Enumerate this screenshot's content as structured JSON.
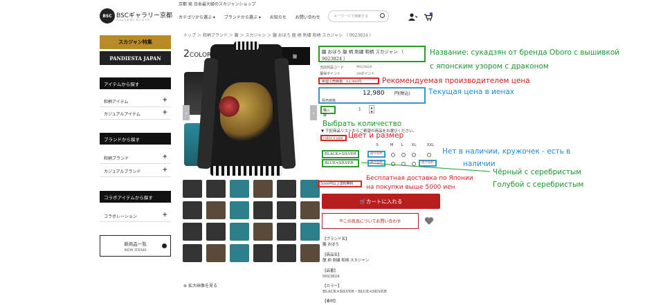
{
  "top_tagline": "京都 発 日本最大級のスカジャンショップ",
  "logo": {
    "mark": "BSC",
    "name": "BSCギャラリー京都",
    "sub": "GALLERY KYOTO"
  },
  "nav": [
    "カテゴリから選ぶ ▾",
    "ブランドから選ぶ ▾",
    "お知らせ",
    "お問い合わせ"
  ],
  "search": {
    "placeholder": "キーワードで検索する"
  },
  "sidebar": {
    "banners": [
      "スカジャン特集",
      "PANDIESTA JAPAN"
    ],
    "sections": [
      {
        "title": "アイテムから探す",
        "items": [
          "和柄アイテム",
          "カジュアルアイテム"
        ]
      },
      {
        "title": "ブランドから探す",
        "items": [
          "和柄ブランド",
          "カジュアルブランド"
        ]
      },
      {
        "title": "コラボアイテムから探す",
        "items": [
          "コラボレーション"
        ]
      }
    ],
    "new_items": {
      "title": "新商品一覧",
      "sub": "NEW ITEMS"
    }
  },
  "breadcrumb": "トップ ＞ 和柄ブランド ＞ 朧 ＞ スカジャン ＞ 朧 おぼろ 龍 柄 刺繍 和柄 スカジャン （ 9023824 ）",
  "gallery": {
    "color_count": "2",
    "color_word": "COLOR",
    "brand_logo": "朧",
    "zoom_label": "拡大画像を見る"
  },
  "product": {
    "title": "朧 おぼろ 龍 柄 刺繍 和柄 スカジャン （ 9023824 ）",
    "code_label": "当店商品コード",
    "code": "9023824",
    "points_label": "獲得ポイント",
    "points": "39ポイント",
    "rec_label": "希望小売価格",
    "rec_price": "12,980円",
    "price": "12,980",
    "price_tax": "円(税込)",
    "price_label": "販売価格",
    "qty_label": "購入数",
    "qty": "1",
    "select_note": "▼ 下記商品リストからご希望の商品をお選びください。",
    "color_size": "color x size",
    "sizes": [
      "S",
      "M",
      "L",
      "XL",
      "XXL"
    ],
    "variants": [
      "BLACK×SILVER",
      "BLUE×SILVER"
    ],
    "sold_out": "売り切れ",
    "shipping": "5000円以上送料無料",
    "cart_button": "カートに入れる",
    "contact_button": "この商品についてお問い合わせ",
    "desc": [
      "【ブランド名】",
      "朧 おぼろ",
      "",
      "【商品名】",
      "龍 柄 刺繍 和柄 スカジャン",
      "",
      "【品番】",
      "9023824",
      "",
      "【カラー】",
      "BLACK×SILVER・BLUE×SILVER",
      "",
      "【素材】"
    ]
  },
  "annotations": {
    "name1": "Название: сукадзян от бренда Oboro с вышивкой",
    "name2": "с японским узором с драконом",
    "rec": "Рекомендуемая производителем цена",
    "price": "Текущая цена в иенах",
    "qty": "Выбрать количество",
    "color_size": "Цвет и размер",
    "stock1": "Нет в наличии, кружочек - есть в",
    "stock2": "наличии",
    "variant1": "Чёрный с серебристым",
    "variant2": "Голубой с серебристым",
    "ship1": "Бесплатная доставка по Японии",
    "ship2": "на покупки выше 5000 иен"
  },
  "colors": {
    "green": "#1a9a2a",
    "red": "#d41e1e",
    "blue": "#1b8ccf",
    "cart": "#b81d1d"
  }
}
